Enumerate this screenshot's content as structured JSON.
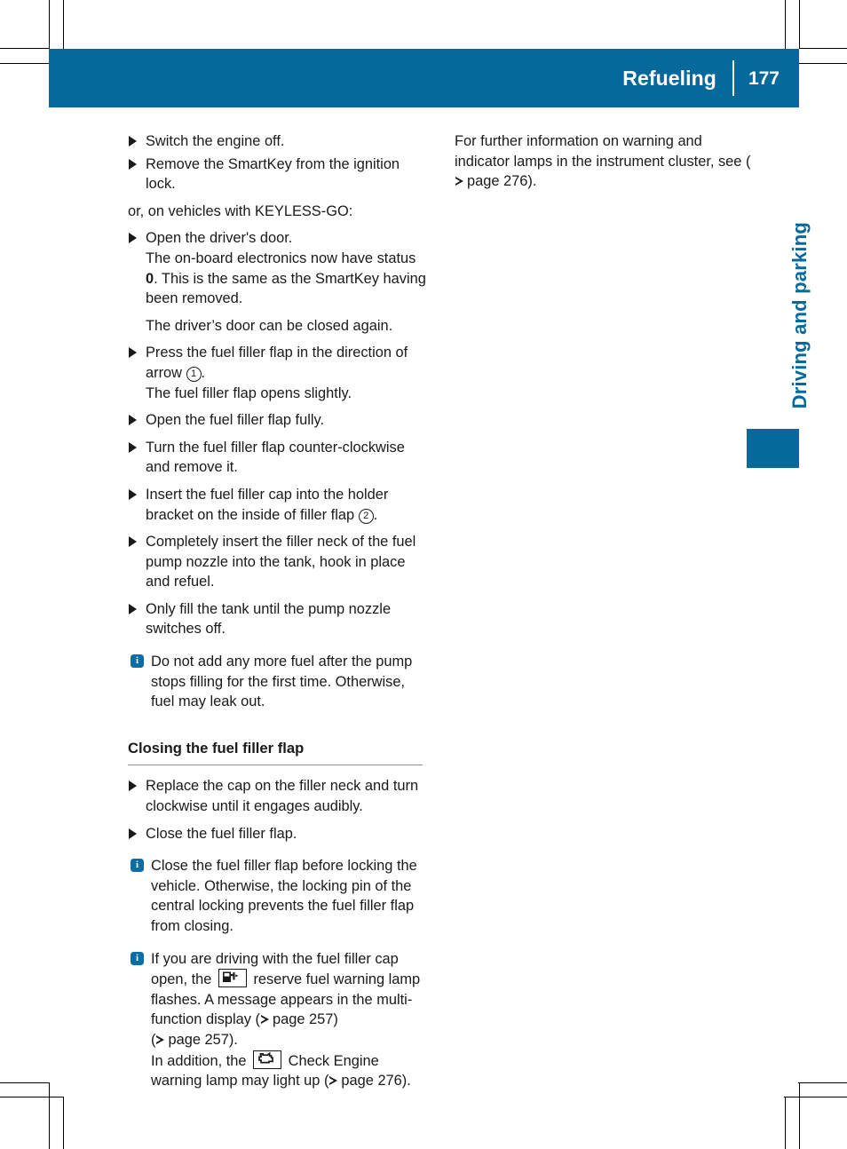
{
  "header": {
    "title": "Refueling",
    "page_number": "177",
    "accent_color": "#05699b"
  },
  "side_tab": {
    "chapter_label": "Driving and parking",
    "color": "#05699b"
  },
  "icons": {
    "bullet": "triangle-bullet-icon",
    "info": "info-icon",
    "reference_arrow": "page-reference-arrow-icon",
    "reserve_fuel_lamp": "reserve-fuel-warning-lamp-icon",
    "check_engine_lamp": "check-engine-warning-lamp-icon"
  },
  "left_column": {
    "steps_group_1": [
      "Switch the engine off.",
      "Remove the SmartKey from the ignition lock."
    ],
    "keyless_intro": "or, on vehicles with KEYLESS-GO:",
    "open_door_step": "Open the driver's door.",
    "open_door_sub_a_pre": "The on-board electronics now have status ",
    "open_door_sub_a_bold": "0",
    "open_door_sub_a_post": ". This is the same as the SmartKey having been removed.",
    "open_door_sub_b": "The driver’s door can be closed again.",
    "press_flap_pre": "Press the fuel filler flap in the direction of arrow ",
    "press_flap_marker": "1",
    "press_flap_post": ".",
    "press_flap_sub": "The fuel filler flap opens slightly.",
    "steps_group_2": [
      "Open the fuel filler flap fully.",
      "Turn the fuel filler flap counter-clockwise and remove it."
    ],
    "insert_cap_pre": "Insert the fuel filler cap into the holder bracket on the inside of filler flap ",
    "insert_cap_marker": "2",
    "insert_cap_post": ".",
    "steps_group_3": [
      "Completely insert the filler neck of the fuel pump nozzle into the tank, hook in place and refuel.",
      "Only fill the tank until the pump nozzle switches off."
    ],
    "note_1": "Do not add any more fuel after the pump stops filling for the first time. Otherwise, fuel may leak out.",
    "section_heading": "Closing the fuel filler flap",
    "steps_group_4": [
      "Replace the cap on the filler neck and turn clockwise until it engages audibly.",
      "Close the fuel filler flap."
    ],
    "note_2": "Close the fuel filler flap before locking the vehicle. Otherwise, the locking pin of the central locking prevents the fuel filler flap from closing.",
    "note_3": {
      "part_1": "If you are driving with the fuel filler cap open, the ",
      "part_2": " reserve fuel warning lamp flashes. A message appears in the multi-function display (",
      "page_ref_1": "page 257",
      "part_3": ")",
      "line_2_open": "(",
      "page_ref_2": "page 257",
      "line_2_close": ").",
      "part_4": "In addition, the ",
      "part_5": " Check Engine warning lamp may light up (",
      "page_ref_3": "page 276",
      "part_6": ")."
    }
  },
  "right_column": {
    "paragraph_pre": "For further information on warning and indicator lamps in the instrument cluster, see (",
    "page_ref": "page 276",
    "paragraph_post": ")."
  }
}
